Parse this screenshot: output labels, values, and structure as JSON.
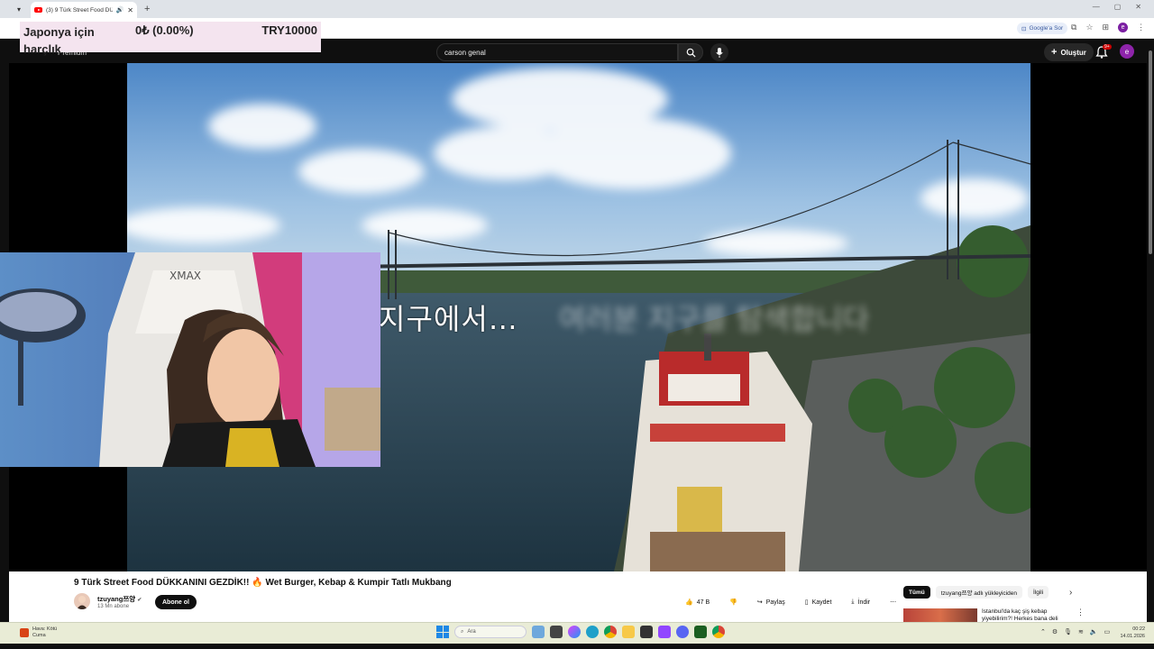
{
  "browser": {
    "tab_title": "(3) 9 Türk Street Food DÜK",
    "new_tab_icon": "plus-icon",
    "google_sor_label": "Google'a Sor",
    "profile_initial": "e"
  },
  "overlay": {
    "title": "Japonya için harçlık",
    "change": "0₺ (0.00%)",
    "goal": "TRY10000"
  },
  "youtube": {
    "logo_text": "Premium",
    "search_value": "carson genal",
    "create_label": "Oluştur",
    "notification_badge": "9+",
    "avatar_initial": "e"
  },
  "video": {
    "subtitle_visible": "지구에서…",
    "subtitle_blurred": "여러분 지구를 탐색합니다"
  },
  "info": {
    "title": "9 Türk Street Food DÜKKANINI GEZDİK!! 🔥 Wet Burger, Kebap & Kumpir Tatlı Mukbang",
    "channel_name": "tzuyang쯔양",
    "subscribers": "13 Mn abone",
    "subscribe_label": "Abone ol",
    "likes": "47 B",
    "share_label": "Paylaş",
    "save_label": "Kaydet",
    "download_label": "İndir"
  },
  "chips": [
    {
      "label": "Tümü"
    },
    {
      "label": "tzuyang쯔양 adlı yükleyiciden"
    },
    {
      "label": "İlgili"
    }
  ],
  "recommendation": {
    "title": "İstanbul'da kaç şiş kebap yiyebilirim?! Herkes bana deli"
  },
  "taskbar": {
    "weather_line1": "Hava: Kötü",
    "weather_line2": "Cuma",
    "search_placeholder": "Ara",
    "time": "00:22",
    "date": "14.01.2026"
  },
  "colors": {
    "youtube_red": "#ff0000",
    "overlay_bg": "#f4e4ef",
    "taskbar_bg": "#e9ecd6"
  }
}
